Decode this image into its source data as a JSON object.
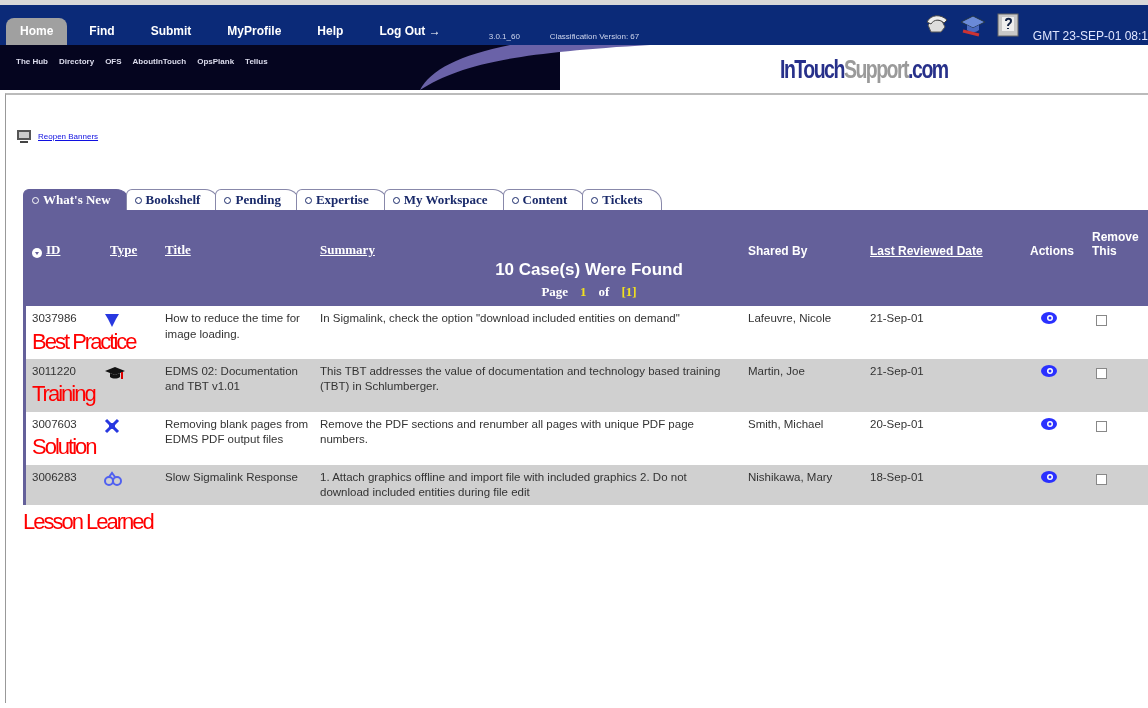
{
  "top_nav": {
    "items": [
      {
        "label": "Home",
        "selected": true
      },
      {
        "label": "Find",
        "selected": false
      },
      {
        "label": "Submit",
        "selected": false
      },
      {
        "label": "MyProfile",
        "selected": false
      },
      {
        "label": "Help",
        "selected": false
      },
      {
        "label": "Log Out →",
        "selected": false
      }
    ],
    "version": "3.0.1_60",
    "classification": "Classification Version: 67",
    "clock": "GMT 23-SEP-01 08:1"
  },
  "sub_nav": [
    "The Hub",
    "Directory",
    "OFS",
    "AboutInTouch",
    "OpsPlank",
    "Tellus"
  ],
  "logo": {
    "part_1": "InTouch",
    "part_2": "Support",
    "part_3": ".com"
  },
  "reopen_link": "Reopen Banners",
  "tabs": [
    {
      "label": "What's New",
      "selected": true
    },
    {
      "label": "Bookshelf",
      "selected": false
    },
    {
      "label": "Pending",
      "selected": false
    },
    {
      "label": "Expertise",
      "selected": false
    },
    {
      "label": "My Workspace",
      "selected": false
    },
    {
      "label": "Content",
      "selected": false
    },
    {
      "label": "Tickets",
      "selected": false
    }
  ],
  "table": {
    "columns": [
      {
        "label": "ID",
        "sortable": true
      },
      {
        "label": "Type",
        "sortable": true
      },
      {
        "label": "Title",
        "sortable": true
      },
      {
        "label": "Summary",
        "sortable": true
      },
      {
        "label": "Shared By",
        "sortable": false
      },
      {
        "label": "Last Reviewed Date",
        "sortable": true
      },
      {
        "label": "Actions",
        "sortable": false
      },
      {
        "label": "Remove This",
        "sortable": false
      }
    ],
    "result_count": "10 Case(s) Were Found",
    "pager": [
      {
        "text": "Page",
        "kind": "label"
      },
      {
        "text": "1",
        "kind": "current"
      },
      {
        "text": "of",
        "kind": "label"
      },
      {
        "text": "[1]",
        "kind": "link"
      }
    ],
    "rows": [
      {
        "id": "3037986",
        "kind": "best_practice",
        "title": "How to reduce the time for image loading.",
        "summary": "In Sigmalink, check the option \"download included entities on demand\"",
        "shared_by": "Lafeuvre, Nicole",
        "date": "21-Sep-01",
        "label": "Best Practice",
        "checked": false
      },
      {
        "id": "3011220",
        "kind": "training",
        "title": "EDMS 02: Documentation and TBT v1.01",
        "summary": "This TBT addresses the value of documentation and technology based training (TBT) in Schlumberger.",
        "shared_by": "Martin, Joe",
        "date": "21-Sep-01",
        "label": "Training",
        "checked": false
      },
      {
        "id": "3007603",
        "kind": "solution",
        "title": "Removing blank pages from EDMS PDF output files",
        "summary": "Remove the PDF sections and renumber all pages with unique PDF page numbers.",
        "shared_by": "Smith, Michael",
        "date": "20-Sep-01",
        "label": "Solution",
        "checked": false
      },
      {
        "id": "3006283",
        "kind": "lesson",
        "title": "Slow Sigmalink Response",
        "summary": "1. Attach graphics offline and import file with included graphics 2. Do not download included entities during file edit",
        "shared_by": "Nishikawa, Mary",
        "date": "18-Sep-01",
        "label": "Lesson Learned",
        "checked": false
      }
    ]
  }
}
